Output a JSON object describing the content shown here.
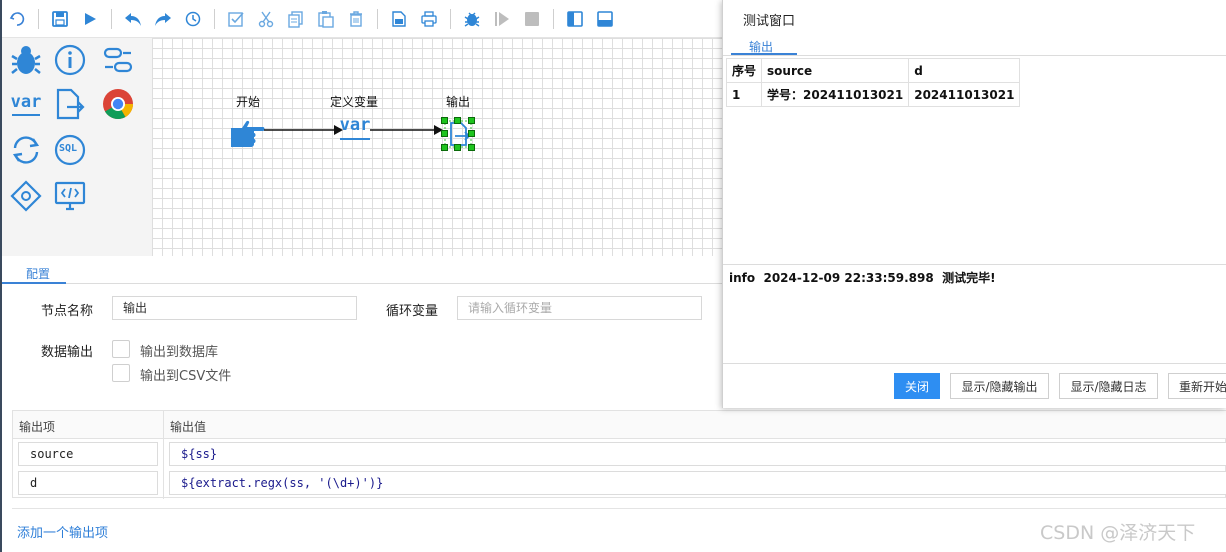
{
  "toolbar": {
    "buttons": [
      "undo-icon",
      "save-icon",
      "run-icon",
      "undo-arrow-icon",
      "redo-arrow-icon",
      "history-icon",
      "select-all-icon",
      "cut-icon",
      "copy-icon",
      "paste-icon",
      "delete-icon",
      "export-icon",
      "print-icon",
      "debug-icon",
      "step-icon",
      "stop-icon",
      "layout-left-icon",
      "layout-bottom-icon"
    ]
  },
  "palette": {
    "items": [
      "debug-bug-icon",
      "info-icon",
      "link-icon",
      "variable-icon",
      "output-icon",
      "chrome-icon",
      "loop-icon",
      "sql-icon",
      "diamond-icon",
      "code-icon"
    ],
    "var_text": "var",
    "sql_text": "SQL"
  },
  "canvas": {
    "nodes": [
      {
        "label": "开始",
        "icon": "pointing-hand-icon"
      },
      {
        "label": "定义变量",
        "icon": "var-icon"
      },
      {
        "label": "输出",
        "icon": "output-icon"
      }
    ],
    "var_text": "var"
  },
  "config": {
    "tab_label": "配置",
    "node_name_label": "节点名称",
    "node_name_value": "输出",
    "loop_var_label": "循环变量",
    "loop_var_placeholder": "请输入循环变量",
    "data_output_label": "数据输出",
    "output_db_label": "输出到数据库",
    "output_csv_label": "输出到CSV文件",
    "table_headers": [
      "输出项",
      "输出值"
    ],
    "rows": [
      {
        "item": "source",
        "value": "${ss}"
      },
      {
        "item": "d",
        "value": "${extract.regx(ss, '(\\d+)')}"
      }
    ],
    "add_link": "添加一个输出项"
  },
  "test_window": {
    "title": "测试窗口",
    "tab_label": "输出",
    "headers": [
      "序号",
      "source",
      "d"
    ],
    "rows": [
      [
        "1",
        "学号：202411013021",
        "202411013021"
      ]
    ],
    "log": "info  2024-12-09 22:33:59.898  测试完毕!",
    "buttons": {
      "close": "关闭",
      "toggle_output": "显示/隐藏输出",
      "toggle_log": "显示/隐藏日志",
      "restart": "重新开始"
    }
  },
  "watermark": "CSDN @泽济天下",
  "colors": {
    "accent": "#2e8ef2",
    "icon_blue": "#2f86d6",
    "selection_green": "#1ec41e"
  }
}
